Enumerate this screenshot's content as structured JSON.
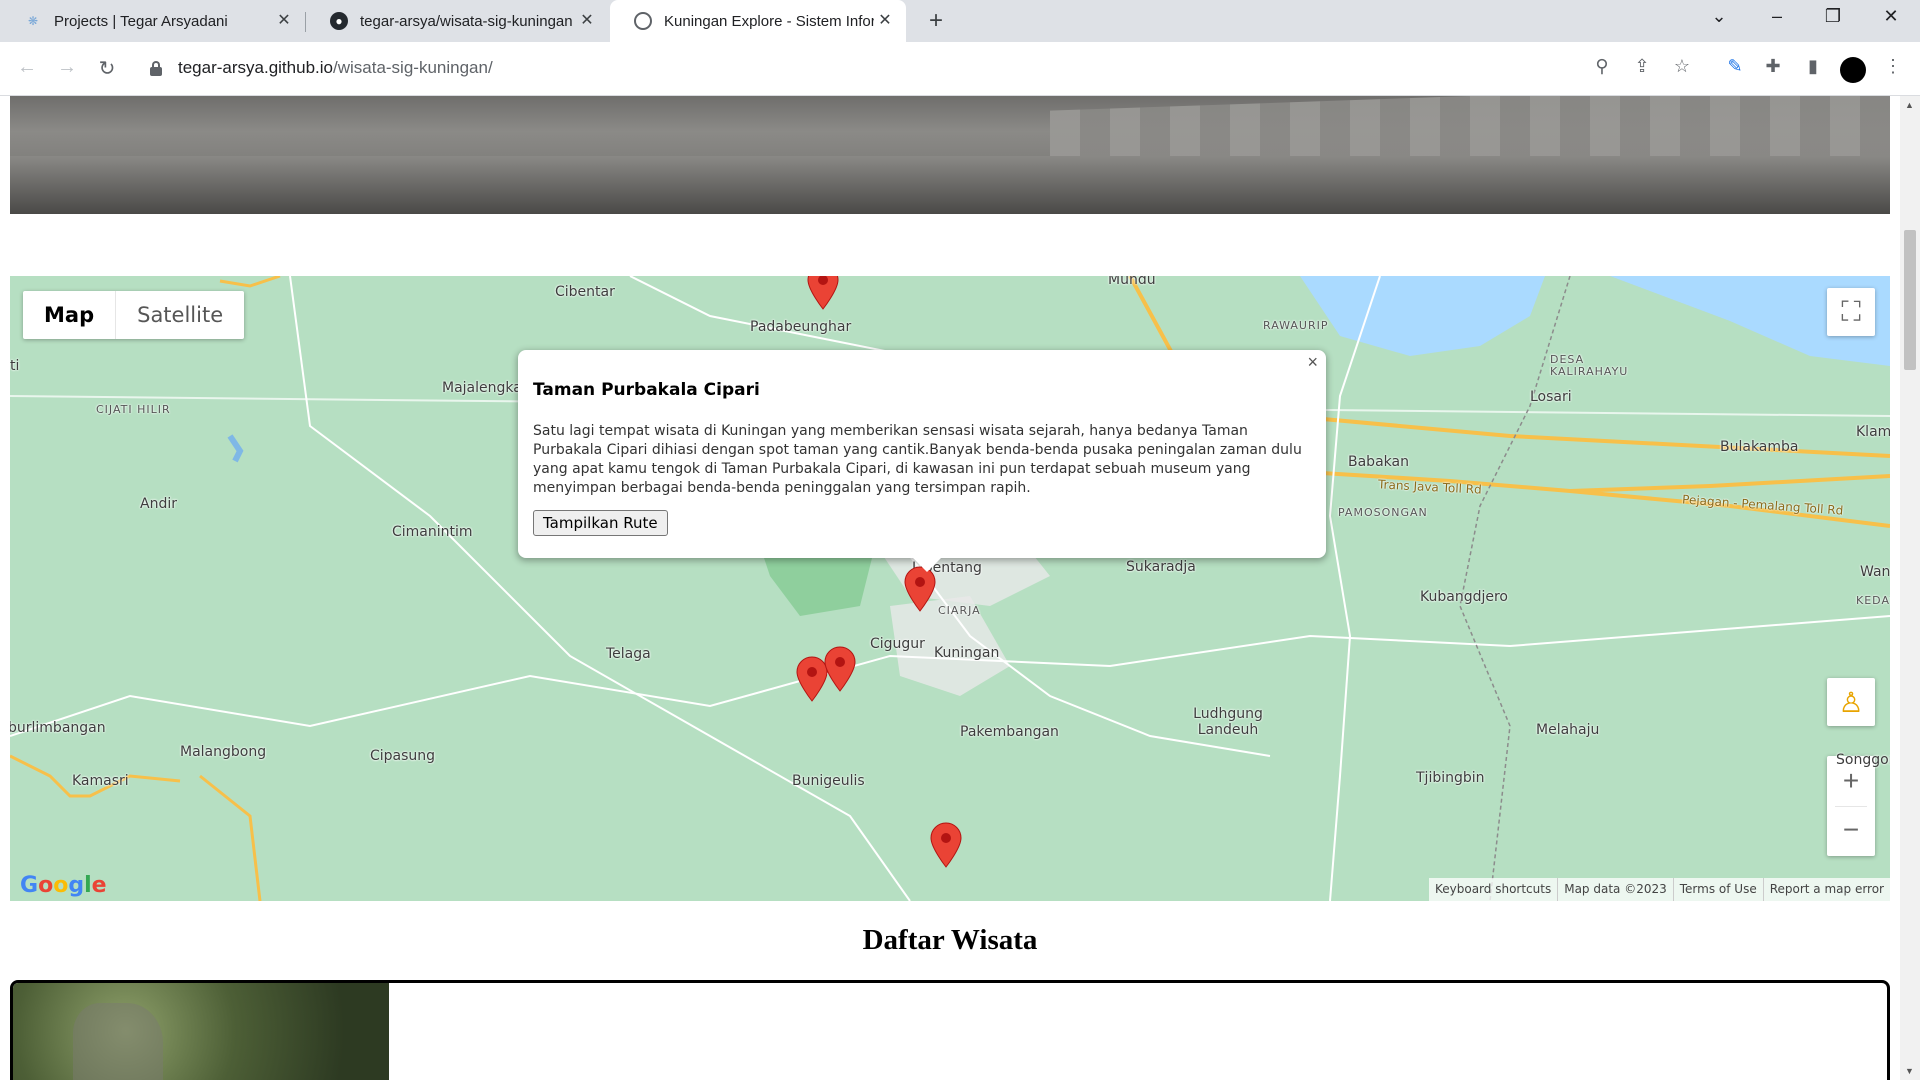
{
  "browser": {
    "tabs": [
      {
        "title": "Projects | Tegar Arsyadani",
        "icon": "tegar-logo-icon"
      },
      {
        "title": "tegar-arsya/wisata-sig-kuningan",
        "icon": "github-icon"
      },
      {
        "title": "Kuningan Explore - Sistem Inform",
        "icon": "globe-icon"
      }
    ],
    "url_host": "tegar-arsya.github.io",
    "url_path": "/wisata-sig-kuningan/"
  },
  "map": {
    "type_map": "Map",
    "type_satellite": "Satellite",
    "google_logo": "Google",
    "attribution": [
      "Keyboard shortcuts",
      "Map data ©2023",
      "Terms of Use",
      "Report a map error"
    ],
    "places": [
      {
        "name": "Cibentar"
      },
      {
        "name": "Padabeunghar"
      },
      {
        "name": "Mundu"
      },
      {
        "name": "RAWAURIP"
      },
      {
        "name": "DESA KALIRAHAYU"
      },
      {
        "name": "Losari"
      },
      {
        "name": "Bulakamba"
      },
      {
        "name": "Klam"
      },
      {
        "name": "CIJATI HILIR"
      },
      {
        "name": "Majalengka"
      },
      {
        "name": "Andir"
      },
      {
        "name": "Cimanintim"
      },
      {
        "name": "Babakan"
      },
      {
        "name": "Trans Java Toll Rd"
      },
      {
        "name": "PAMOSONGAN"
      },
      {
        "name": "Pejagan - Pemalang Toll Rd"
      },
      {
        "name": "Sukaradja"
      },
      {
        "name": "Kubangdjero"
      },
      {
        "name": "Wana"
      },
      {
        "name": "KEDAW"
      },
      {
        "name": "Lipentang"
      },
      {
        "name": "CIARJA"
      },
      {
        "name": "Cigugur"
      },
      {
        "name": "Kuningan"
      },
      {
        "name": "Telaga"
      },
      {
        "name": "Ludhgung Landeuh"
      },
      {
        "name": "Pakembangan"
      },
      {
        "name": "Melahaju"
      },
      {
        "name": "Songgom"
      },
      {
        "name": "Tjibingbin"
      },
      {
        "name": "Bunigeulis"
      },
      {
        "name": "Cipasung"
      },
      {
        "name": "Malangbong"
      },
      {
        "name": "Kamasri"
      },
      {
        "name": "burlimbangan"
      },
      {
        "name": "ti"
      }
    ],
    "popup": {
      "title": "Taman Purbakala Cipari",
      "description": "Satu lagi tempat wisata di Kuningan yang memberikan sensasi wisata sejarah, hanya bedanya Taman Purbakala Cipari dihiasi dengan spot taman yang cantik.Banyak benda-benda pusaka peningalan zaman dulu yang apat kamu tengok di Taman Purbakala Cipari, di kawasan ini pun terdapat sebuah museum yang menyimpan berbagai benda-benda peninggalan yang tersimpan rapih.",
      "button": "Tampilkan Rute",
      "close": "×"
    }
  },
  "section_title": "Daftar Wisata",
  "colors": {
    "marker": "#ea4335",
    "map_bg": "#b6dfc2",
    "water": "#aadaff",
    "road_major": "#f7c04a"
  }
}
